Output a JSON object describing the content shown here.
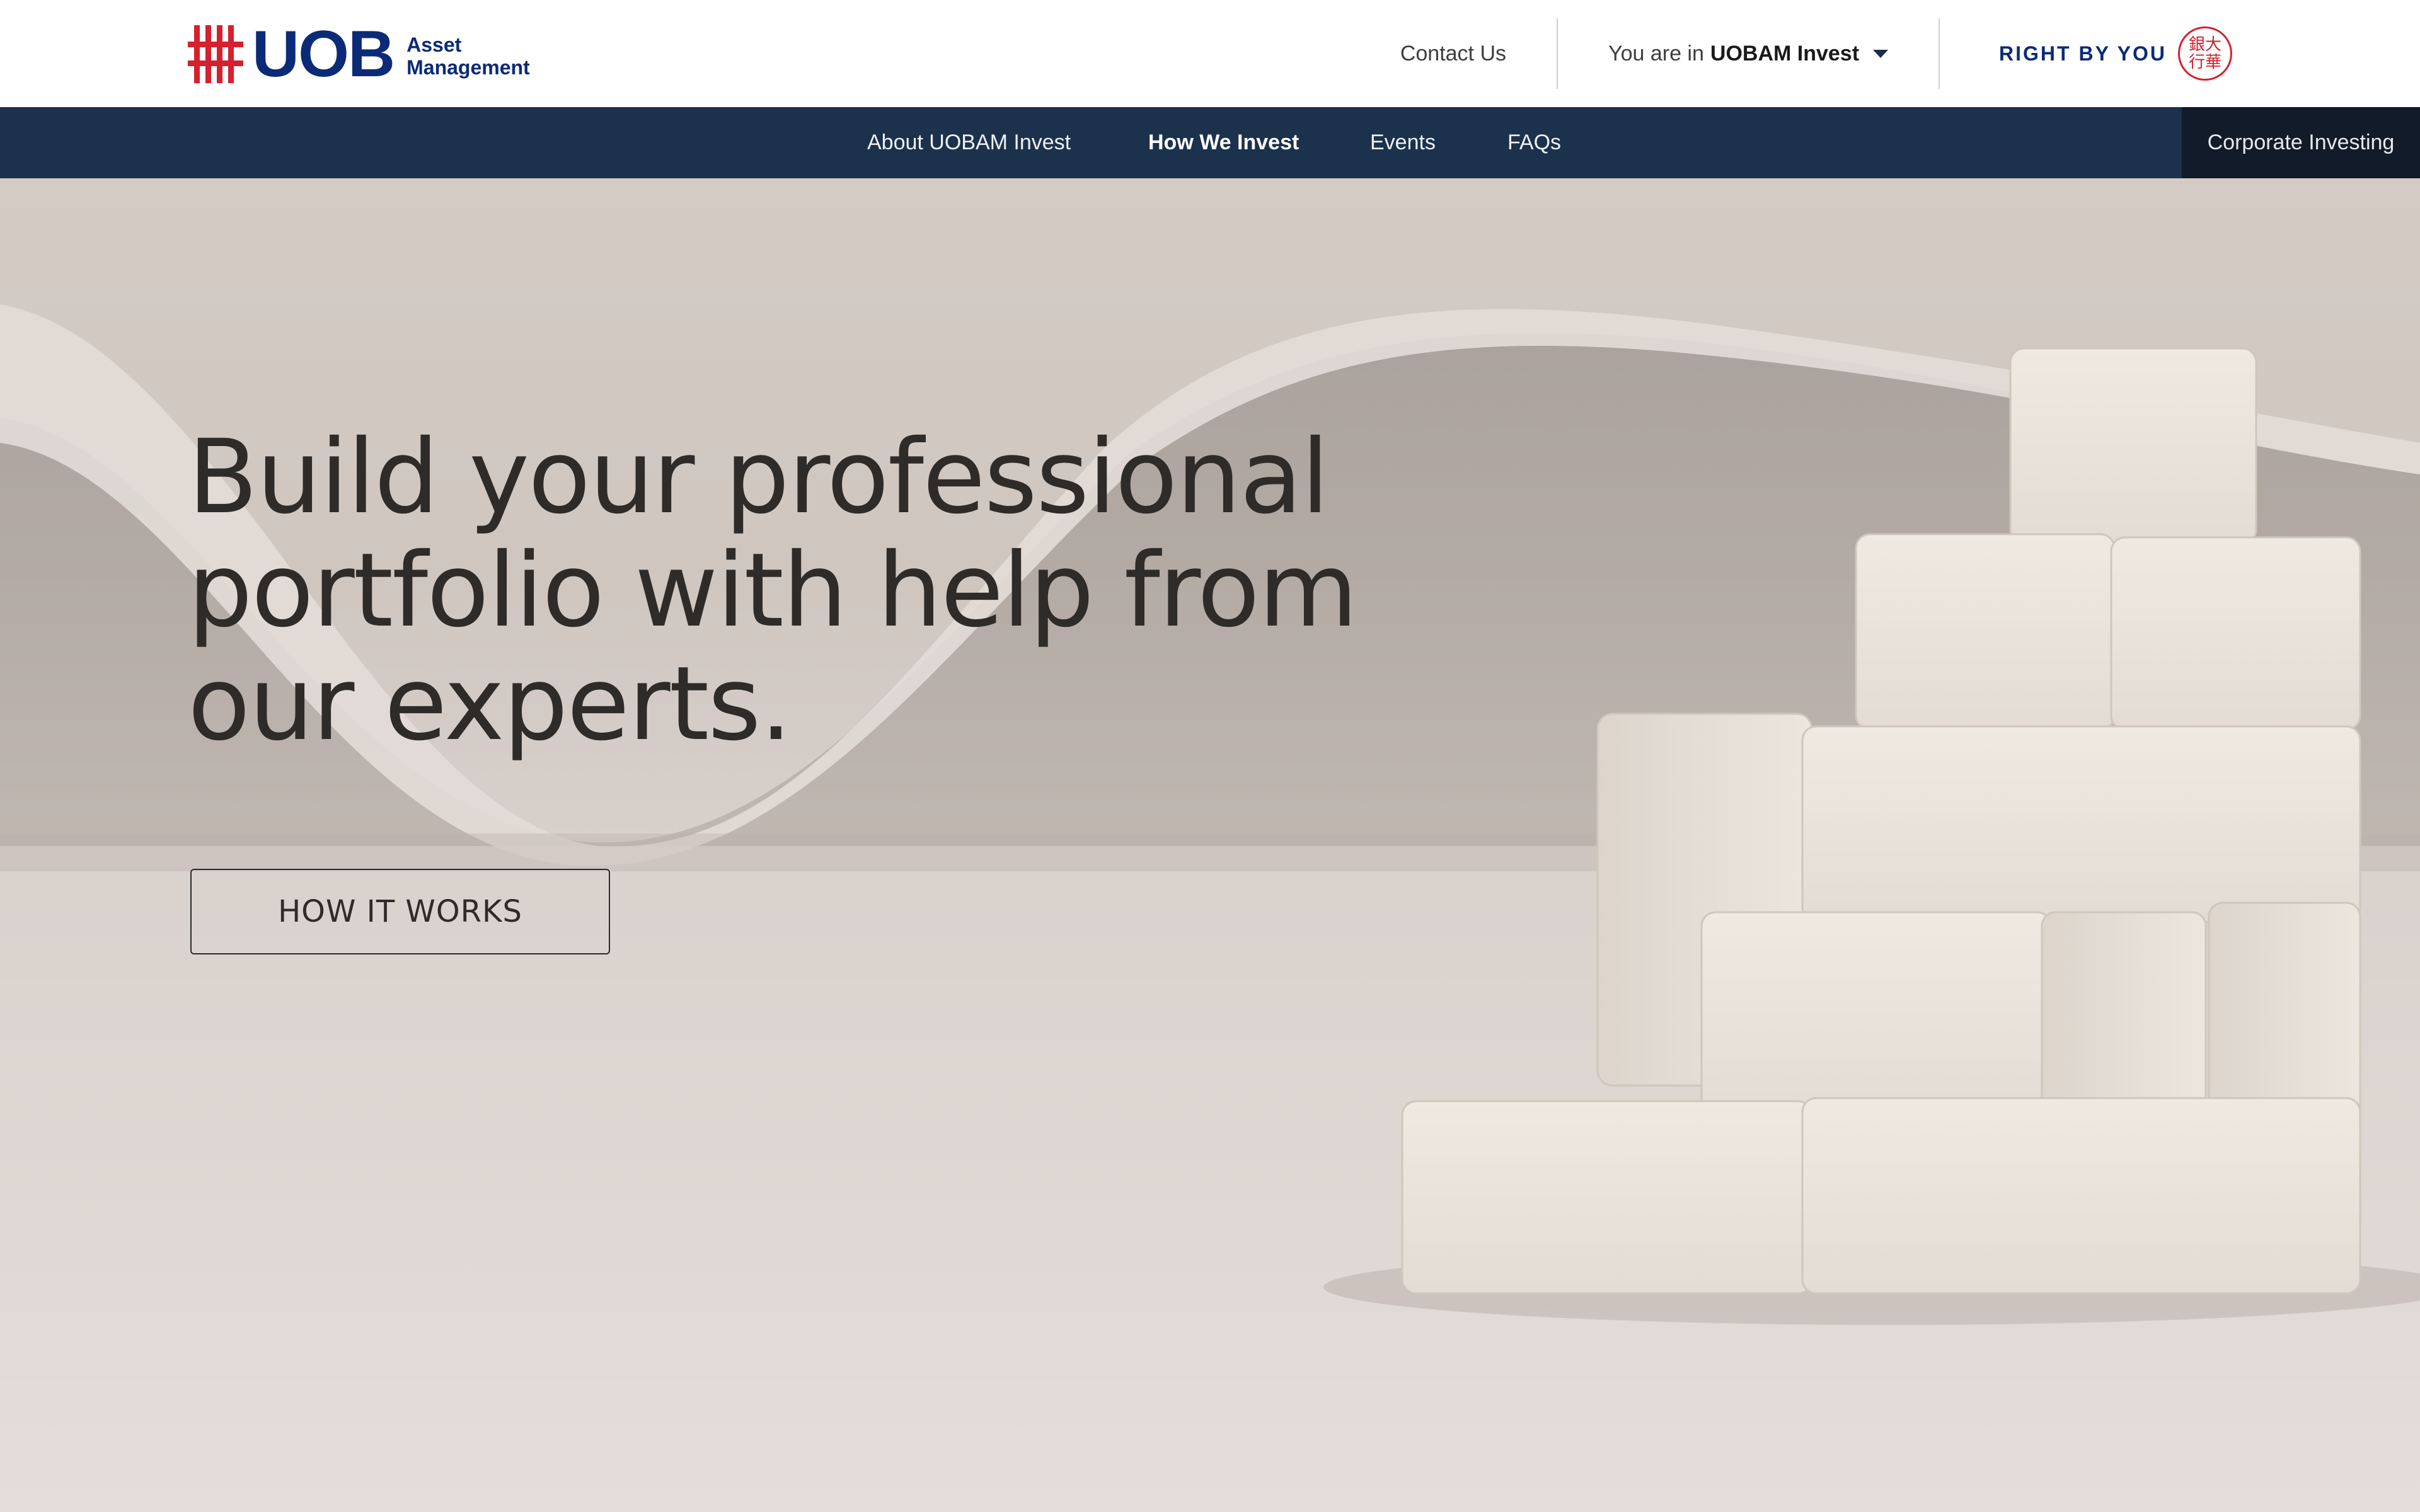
{
  "header": {
    "logo": {
      "word": "UOB",
      "sub_line1": "Asset",
      "sub_line2": "Management"
    },
    "contact_label": "Contact Us",
    "site_selector": {
      "prefix": "You are in",
      "current": "UOBAM Invest"
    },
    "tagline": "RIGHT BY YOU",
    "seal_text": "銀大行華"
  },
  "nav": {
    "items": [
      {
        "label": "About UOBAM Invest",
        "active": false
      },
      {
        "label": "How We Invest",
        "active": true
      },
      {
        "label": "Events",
        "active": false
      },
      {
        "label": "FAQs",
        "active": false
      }
    ],
    "corporate_label": "Corporate Investing"
  },
  "hero": {
    "headline_line1": "Build your professional",
    "headline_line2": "portfolio with help from",
    "headline_line3": "our experts.",
    "cta_label": "HOW IT WORKS"
  },
  "colors": {
    "brand_navy": "#0b2a78",
    "brand_red": "#d5202e",
    "nav_bg": "#1b314c",
    "nav_corporate_bg": "#111b29"
  }
}
